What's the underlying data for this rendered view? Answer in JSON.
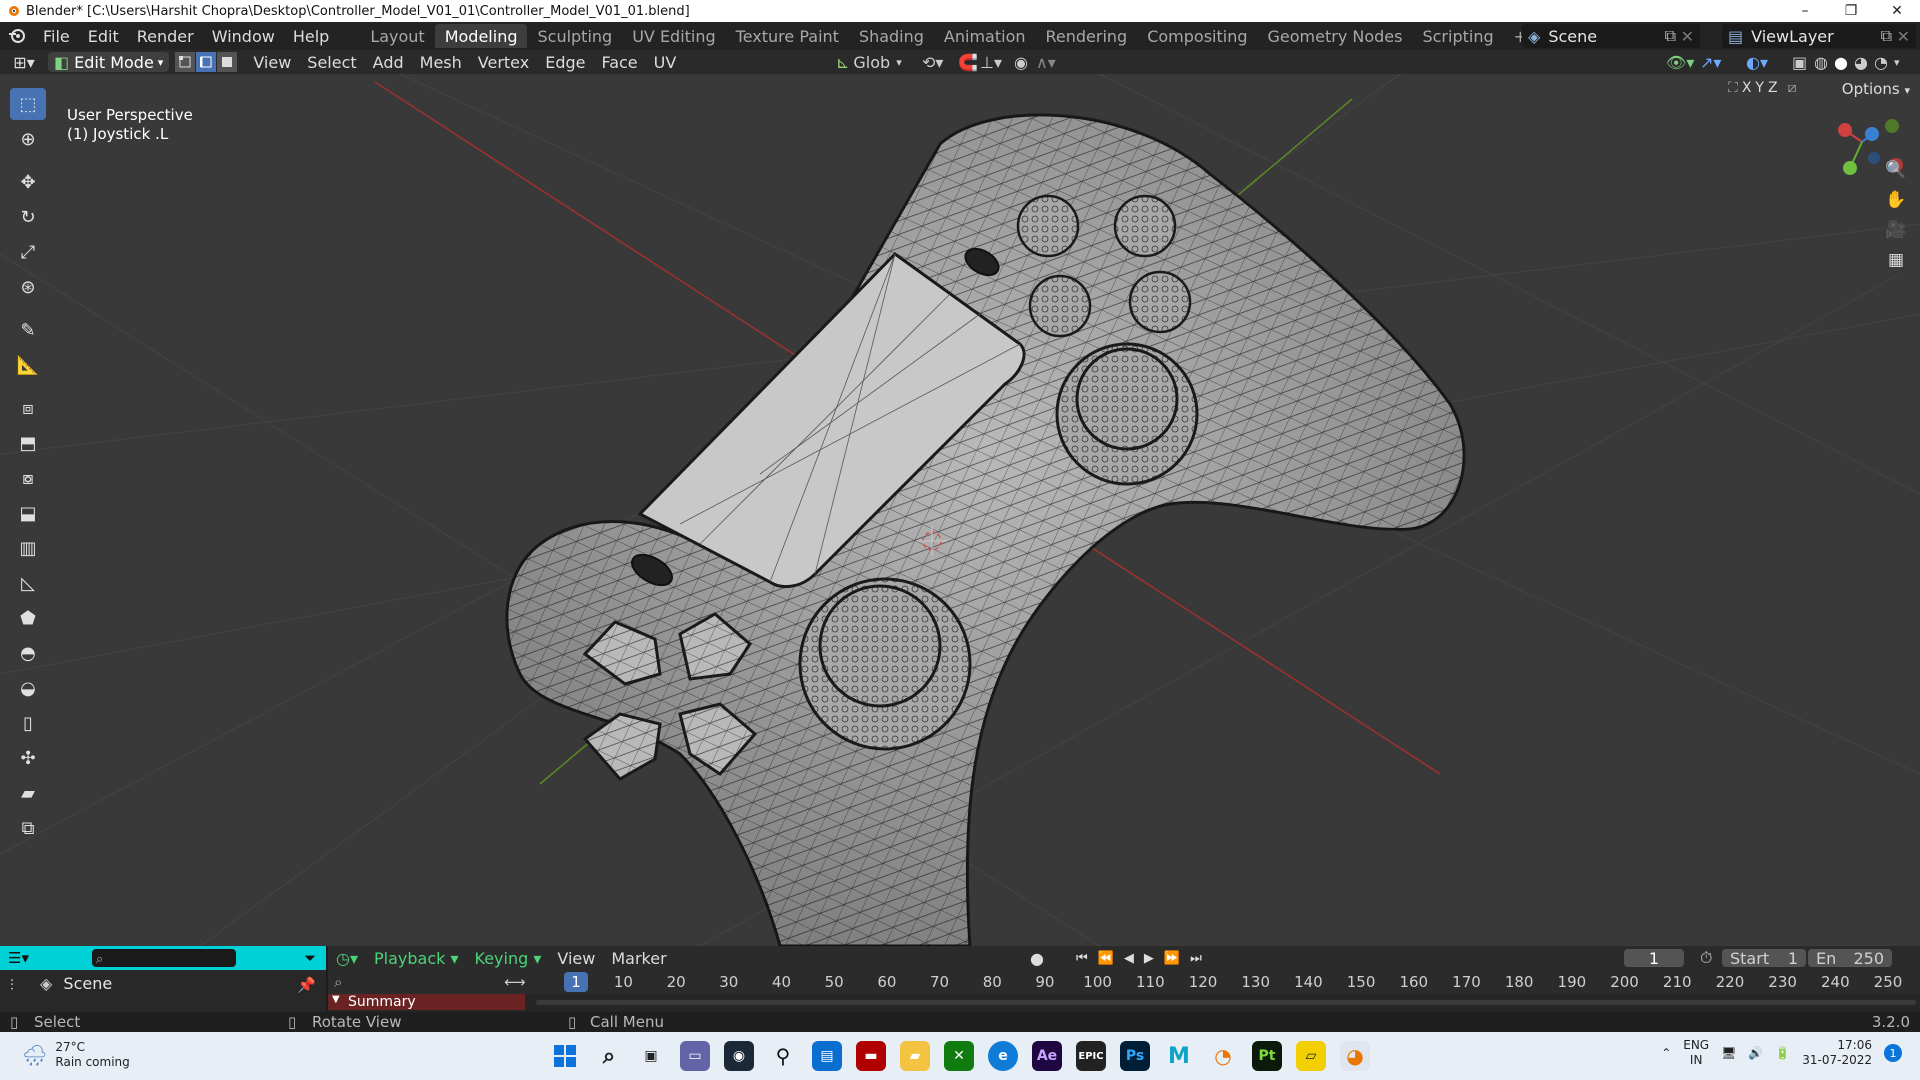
{
  "window": {
    "title": "Blender* [C:\\Users\\Harshit Chopra\\Desktop\\Controller_Model_V01_01\\Controller_Model_V01_01.blend]",
    "controls": [
      "–",
      "❐",
      "✕"
    ]
  },
  "menu": [
    "File",
    "Edit",
    "Render",
    "Window",
    "Help"
  ],
  "workspaces": [
    {
      "label": "Layout",
      "active": false
    },
    {
      "label": "Modeling",
      "active": true
    },
    {
      "label": "Sculpting",
      "active": false
    },
    {
      "label": "UV Editing",
      "active": false
    },
    {
      "label": "Texture Paint",
      "active": false
    },
    {
      "label": "Shading",
      "active": false
    },
    {
      "label": "Animation",
      "active": false
    },
    {
      "label": "Rendering",
      "active": false
    },
    {
      "label": "Compositing",
      "active": false
    },
    {
      "label": "Geometry Nodes",
      "active": false
    },
    {
      "label": "Scripting",
      "active": false
    }
  ],
  "add_workspace": "+",
  "scene_name": "Scene",
  "view_layer": "ViewLayer",
  "viewport_header": {
    "mode": "Edit Mode",
    "menus": [
      "View",
      "Select",
      "Add",
      "Mesh",
      "Vertex",
      "Edge",
      "Face",
      "UV"
    ],
    "transform_orientation": "Glob",
    "options": "Options",
    "mirror_axes": [
      "X",
      "Y",
      "Z"
    ]
  },
  "viewport": {
    "view_name": "User Perspective",
    "object_name": "(1) Joystick .L",
    "accent_selected": "#4772b3",
    "grid_red": "#a03030",
    "grid_green": "#5a8a20"
  },
  "gizmo": {
    "axes": [
      "X",
      "Y",
      "Z"
    ]
  },
  "timeline": {
    "menus": [
      "Playback",
      "Keying",
      "View",
      "Marker"
    ],
    "current_frame": "1",
    "start_label": "Start",
    "start": "1",
    "end_label": "En",
    "end": "250",
    "ticks": [
      "1",
      "10",
      "20",
      "30",
      "40",
      "50",
      "60",
      "70",
      "80",
      "90",
      "100",
      "110",
      "120",
      "130",
      "140",
      "150",
      "160",
      "170",
      "180",
      "190",
      "200",
      "210",
      "220",
      "230",
      "240",
      "250"
    ],
    "summary": "Summary"
  },
  "outliner": {
    "scene_label": "Scene"
  },
  "status": {
    "select": "Select",
    "rotate": "Rotate View",
    "call_menu": "Call Menu",
    "version": "3.2.0"
  },
  "taskbar": {
    "weather_temp": "27°C",
    "weather_desc": "Rain coming",
    "lang": "ENG",
    "region": "IN",
    "time": "17:06",
    "date": "31-07-2022",
    "notif_count": "1"
  }
}
